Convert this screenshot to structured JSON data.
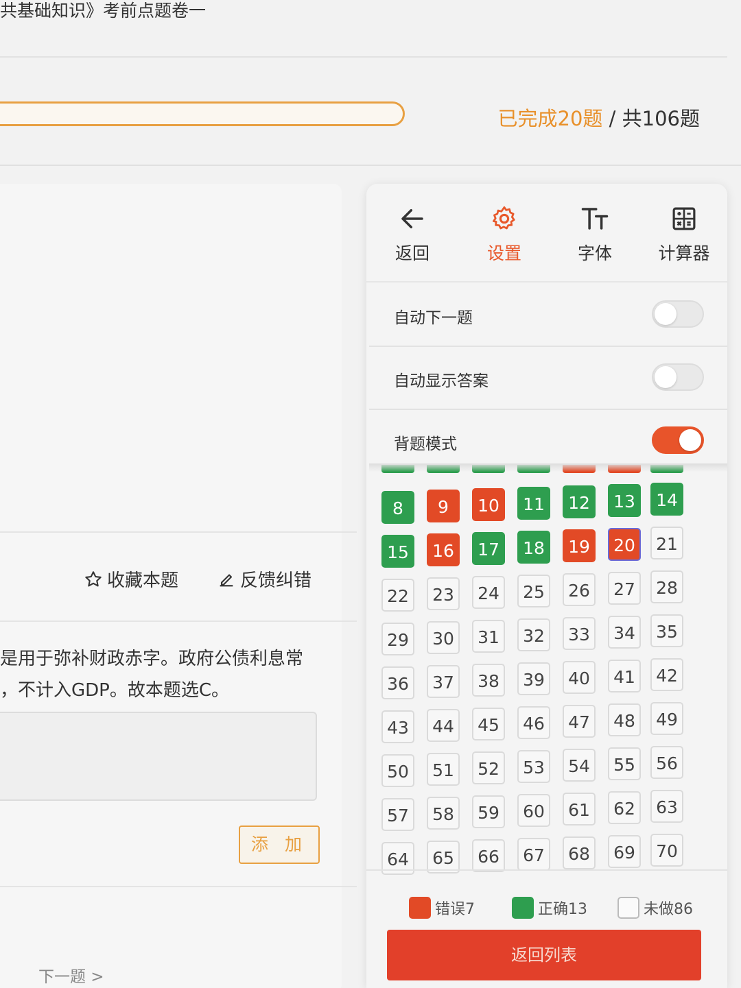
{
  "header": {
    "title": "共基础知识》考前点题卷一",
    "progress_done": "已完成20题",
    "progress_sep": " / ",
    "progress_total": "共106题"
  },
  "question": {
    "favorite_label": "收藏本题",
    "feedback_label": "反馈纠错",
    "explanation_line1": "是用于弥补财政赤字。政府公债利息常",
    "explanation_line2": "，不计入GDP。故本题选C。",
    "add_label": "添 加",
    "next_label": "下一题 >"
  },
  "toolbar": {
    "items": [
      {
        "label": "返回",
        "icon": "arrow-left-icon"
      },
      {
        "label": "设置",
        "icon": "gear-icon"
      },
      {
        "label": "字体",
        "icon": "font-size-icon"
      },
      {
        "label": "计算器",
        "icon": "calculator-icon"
      }
    ],
    "active": "设置"
  },
  "settings": [
    {
      "label": "自动下一题",
      "on": false
    },
    {
      "label": "自动显示答案",
      "on": false
    },
    {
      "label": "背题模式",
      "on": true
    }
  ],
  "answer_sheet": {
    "current": 20,
    "peek_row_status": [
      "correct",
      "correct",
      "correct",
      "correct",
      "wrong",
      "wrong",
      "correct"
    ],
    "status": {
      "8": "correct",
      "9": "wrong",
      "10": "wrong",
      "11": "correct",
      "12": "correct",
      "13": "correct",
      "14": "correct",
      "15": "correct",
      "16": "wrong",
      "17": "correct",
      "18": "correct",
      "19": "wrong",
      "20": "current"
    },
    "visible_range": [
      8,
      70
    ]
  },
  "legend": {
    "wrong": "错误7",
    "correct": "正确13",
    "undone": "未做86"
  },
  "back_to_list_label": "返回列表",
  "colors": {
    "accent_orange": "#e8a042",
    "correct_green": "#2e9e4f",
    "wrong_red": "#e24a26",
    "button_red": "#e2402a"
  }
}
